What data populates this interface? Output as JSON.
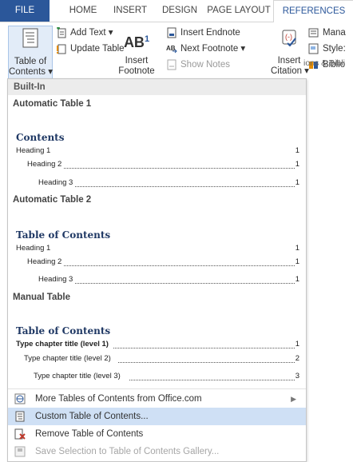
{
  "tabs": [
    "FILE",
    "HOME",
    "INSERT",
    "DESIGN",
    "PAGE LAYOUT",
    "REFERENCES"
  ],
  "ribbon": {
    "toc": {
      "line1": "Table of",
      "line2": "Contents ▾"
    },
    "add_text": "Add Text ▾",
    "update_table": "Update Table",
    "insert_footnote": {
      "line1": "Insert",
      "line2": "Footnote"
    },
    "footnote_glyph": "AB",
    "footnote_sup": "1",
    "insert_endnote": "Insert Endnote",
    "next_footnote": "Next Footnote ▾",
    "show_notes": "Show Notes",
    "insert_citation": {
      "line1": "Insert",
      "line2": "Citation ▾"
    },
    "manage": "Mana",
    "style": "Style:",
    "biblio": "Biblio",
    "group_label": "ions & Bibli"
  },
  "dropdown": {
    "header": "Built-In",
    "auto1": {
      "label": "Automatic Table 1",
      "title": "Contents",
      "h1": "Heading 1",
      "n1": "1",
      "h2": "Heading 2",
      "n2": "1",
      "h3": "Heading 3",
      "n3": "1"
    },
    "auto2": {
      "label": "Automatic Table 2",
      "title": "Table of Contents",
      "h1": "Heading 1",
      "n1": "1",
      "h2": "Heading 2",
      "n2": "1",
      "h3": "Heading 3",
      "n3": "1"
    },
    "manual": {
      "label": "Manual Table",
      "title": "Table of Contents",
      "h1": "Type chapter title (level 1)",
      "n1": "1",
      "h2": "Type chapter title (level 2)",
      "n2": "2",
      "h3": "Type chapter title (level 3)",
      "n3": "3"
    },
    "menu": {
      "more": "More Tables of Contents from Office.com",
      "custom": "Custom Table of Contents...",
      "remove": "Remove Table of Contents",
      "save": "Save Selection to Table of Contents Gallery..."
    }
  }
}
